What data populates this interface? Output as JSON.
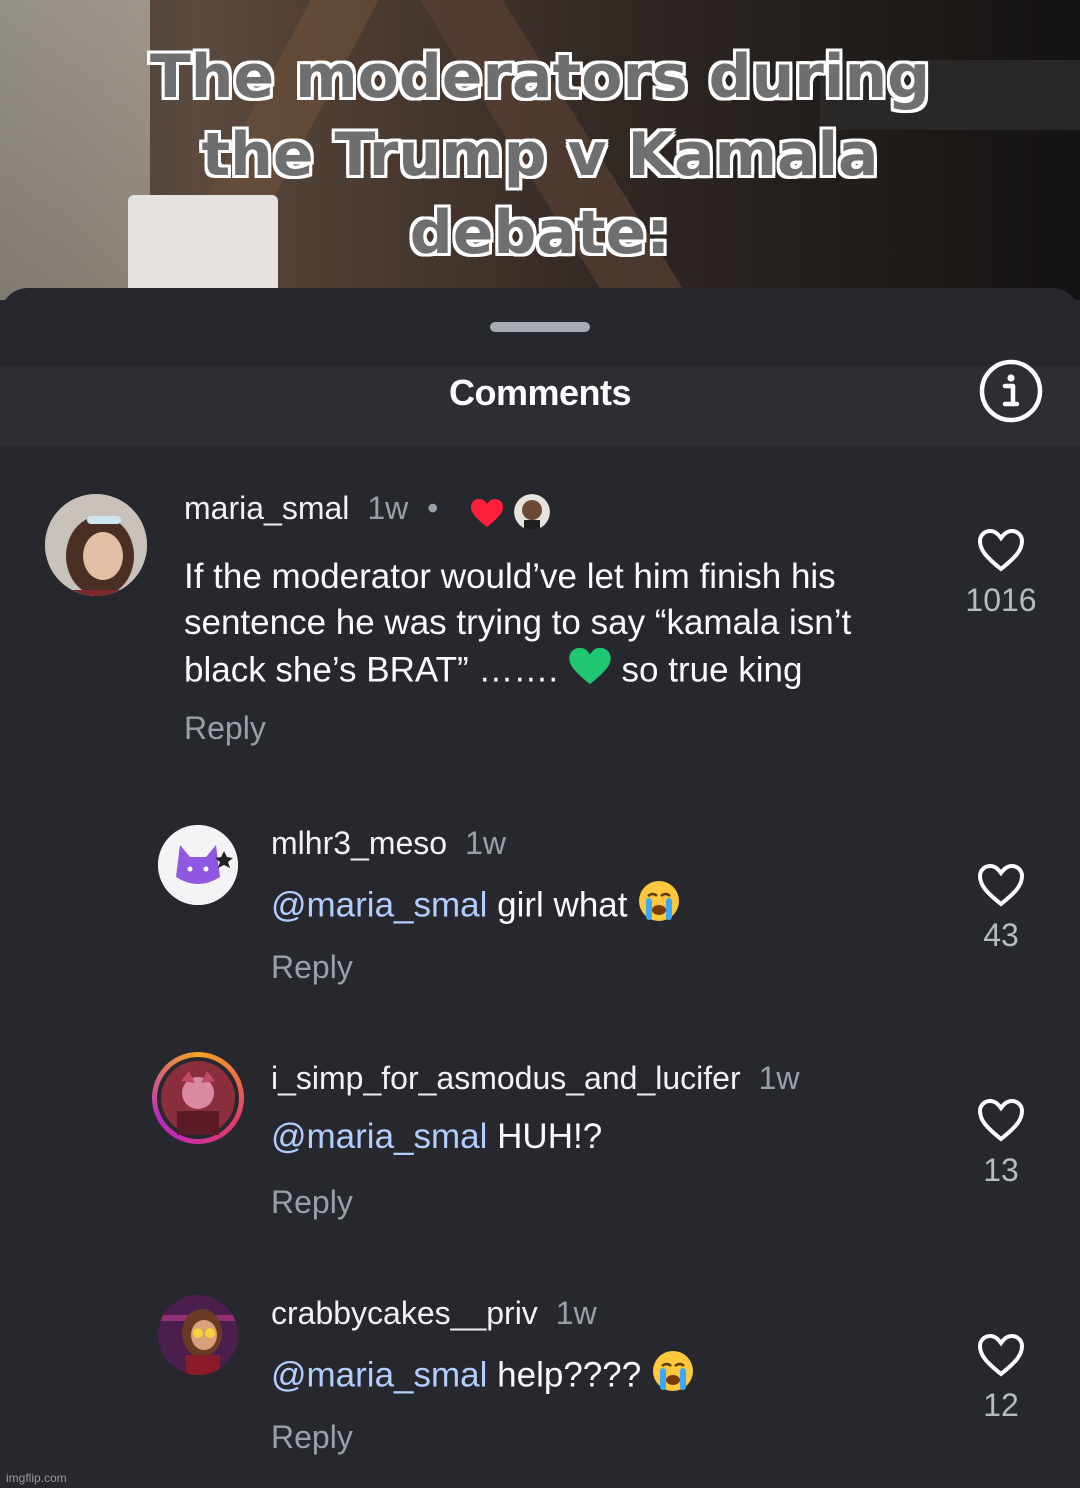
{
  "video": {
    "caption_lines": [
      "The moderators during",
      "the Trump v Kamala",
      "debate:"
    ]
  },
  "sheet": {
    "title": "Comments",
    "info_icon": "info-icon"
  },
  "comments": [
    {
      "username": "maria_smal",
      "time": "1w",
      "text": "If the moderator would’ve let him finish his sentence he was trying to say “kamala isn’t black she’s BRAT” ……. ",
      "text_after_emoji": " so true king",
      "emoji": "green-heart",
      "reply_label": "Reply",
      "likes": "1016",
      "creator_liked": "red-heart-icon"
    },
    {
      "username": "mlhr3_meso",
      "time": "1w",
      "mention": "@maria_smal",
      "text": " girl what ",
      "emoji": "loudly-crying-face",
      "reply_label": "Reply",
      "likes": "43"
    },
    {
      "username": "i_simp_for_asmodus_and_lucifer",
      "time": "1w",
      "mention": "@maria_smal",
      "text": " HUH!?",
      "reply_label": "Reply",
      "likes": "13"
    },
    {
      "username": "crabbycakes__priv",
      "time": "1w",
      "mention": "@maria_smal",
      "text": " help???? ",
      "emoji": "loudly-crying-face",
      "reply_label": "Reply",
      "likes": "12"
    }
  ],
  "watermark": "imgflip.com",
  "colors": {
    "background": "#26282d",
    "mention": "#b2ceff",
    "secondary_text": "#9aa0a8",
    "heart_red": "#ff1f3d"
  }
}
